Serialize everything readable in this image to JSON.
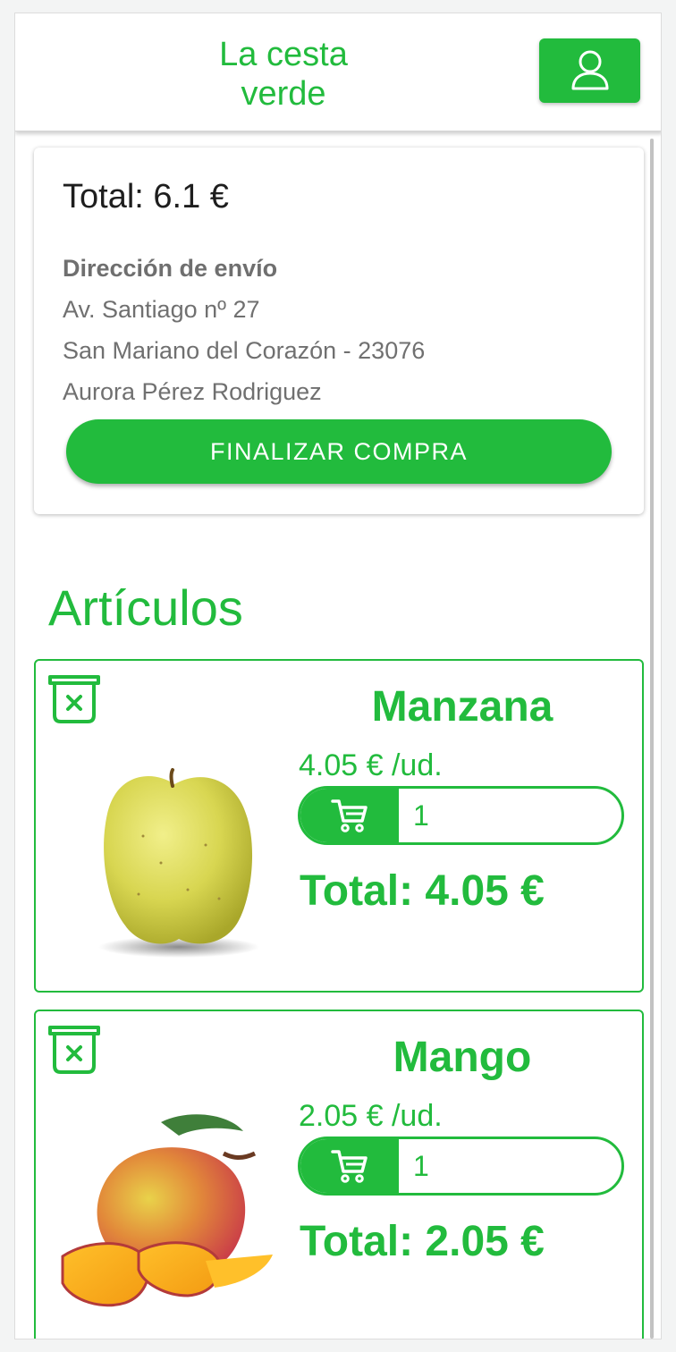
{
  "app": {
    "brand_line1": "La cesta",
    "brand_line2": "verde",
    "brand_color": "#22bb3d",
    "user_button_icon": "user-icon"
  },
  "summary": {
    "total_label": "Total: 6.1 €",
    "address_heading": "Dirección de envío",
    "address_lines": [
      "Av. Santiago nº 27",
      "San Mariano del Corazón - 23076",
      "Aurora Pérez Rodriguez"
    ],
    "finish_button": "FINALIZAR COMPRA"
  },
  "articles": {
    "title": "Artículos",
    "items": [
      {
        "name": "Manzana",
        "unit_price": "4.05 € /ud.",
        "quantity": "1",
        "total": "Total: 4.05 €",
        "image": "apple-image",
        "delete_icon": "trash-icon",
        "cart_icon": "cart-icon"
      },
      {
        "name": "Mango",
        "unit_price": "2.05 € /ud.",
        "quantity": "1",
        "total": "Total: 2.05 €",
        "image": "mango-image",
        "delete_icon": "trash-icon",
        "cart_icon": "cart-icon"
      }
    ]
  }
}
